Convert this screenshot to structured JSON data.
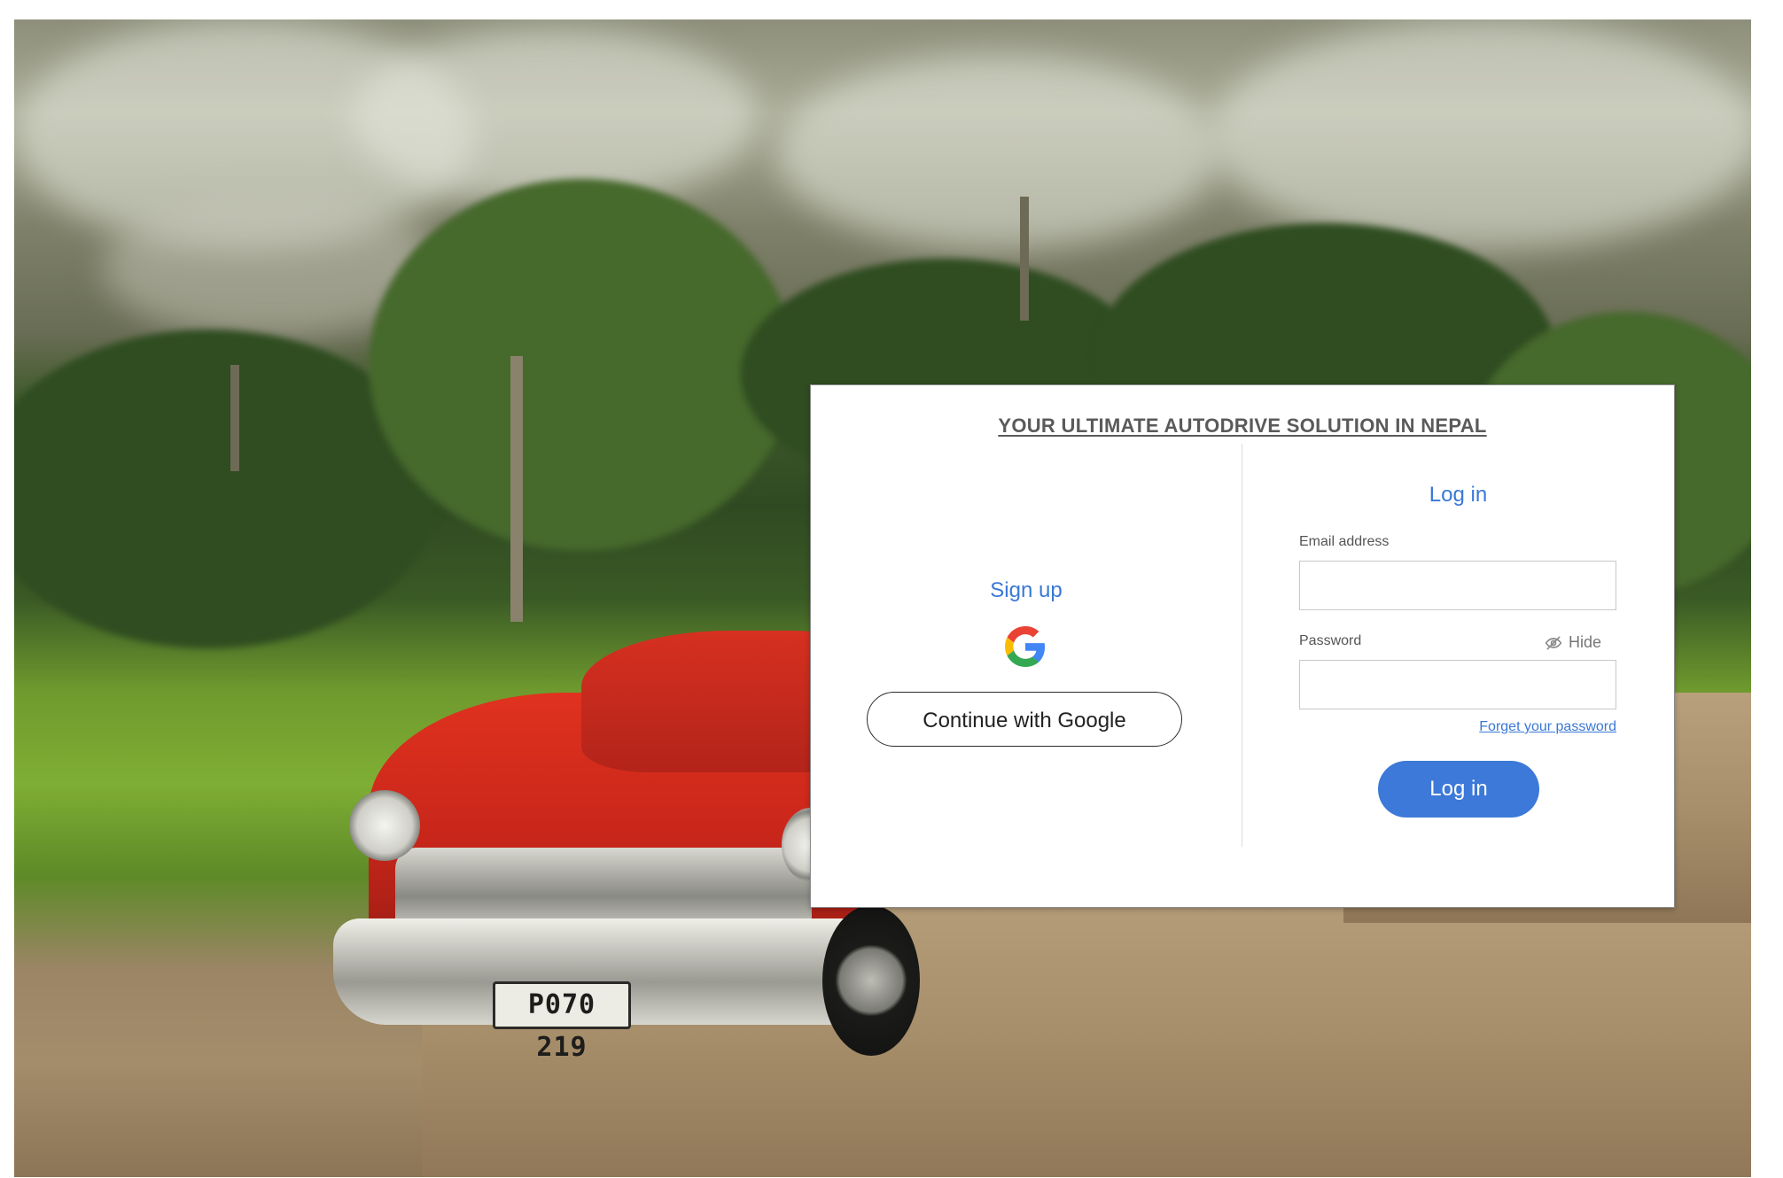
{
  "background": {
    "scene": "vintage-red-car-on-dirt-road",
    "license_plate": "P070 219"
  },
  "card": {
    "tagline": "YOUR ULTIMATE AUTODRIVE SOLUTION IN NEPAL",
    "signup": {
      "title": "Sign up",
      "icon": "google-g-icon",
      "google_button_label": "Continue with Google"
    },
    "login": {
      "title": "Log in",
      "email_label": "Email address",
      "email_value": "",
      "email_placeholder": "",
      "password_label": "Password",
      "password_value": "",
      "password_placeholder": "",
      "hide_label": "Hide",
      "hide_icon": "eye-slash-icon",
      "forgot_label": "Forget your password",
      "submit_label": "Log in"
    }
  },
  "colors": {
    "accent": "#3c79d8",
    "tagline": "#5a5a5a",
    "card_border": "#8c8c8c"
  }
}
